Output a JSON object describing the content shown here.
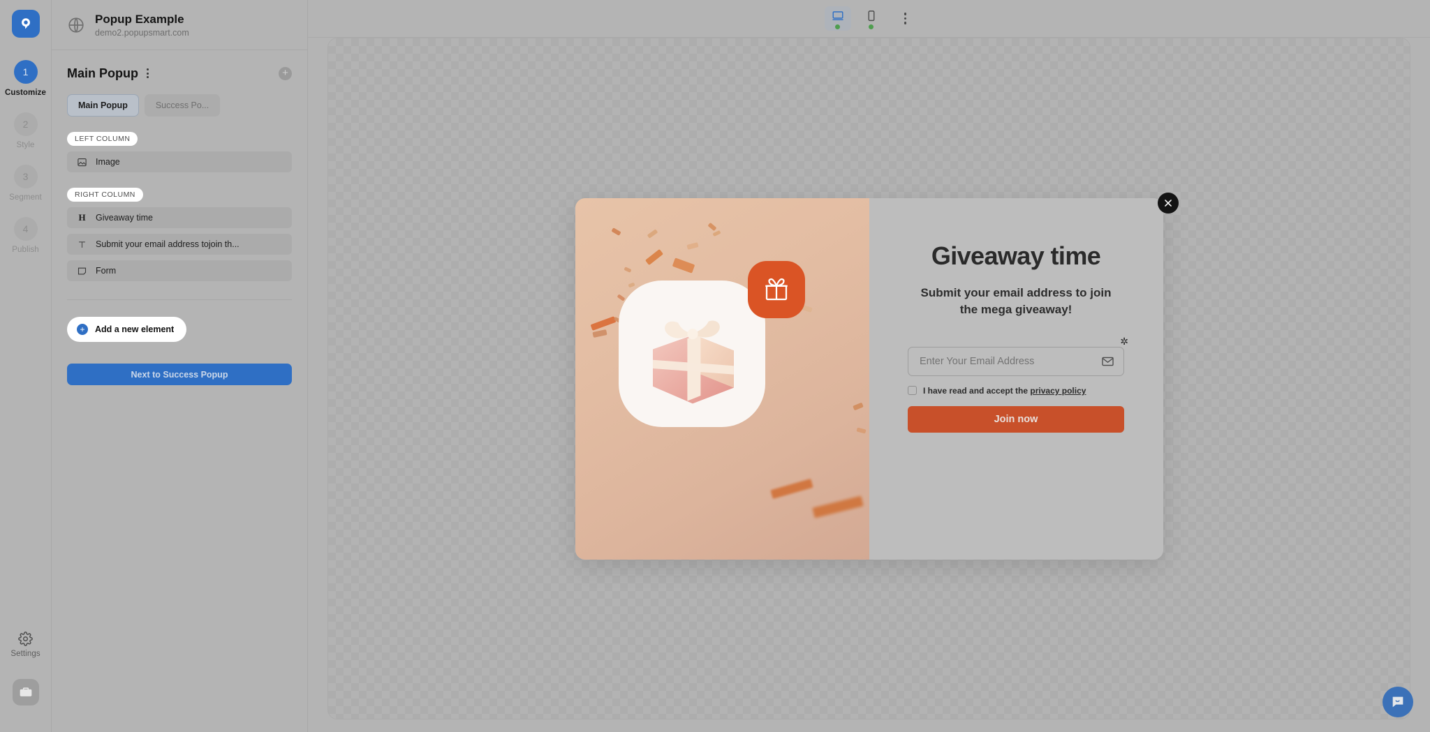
{
  "rail": {
    "logo_icon": "popupsmart-logo-icon",
    "steps": [
      {
        "num": "1",
        "label": "Customize",
        "active": true
      },
      {
        "num": "2",
        "label": "Style",
        "active": false
      },
      {
        "num": "3",
        "label": "Segment",
        "active": false
      },
      {
        "num": "4",
        "label": "Publish",
        "active": false
      }
    ],
    "settings_label": "Settings",
    "settings_icon": "gear-icon",
    "briefcase_icon": "briefcase-icon"
  },
  "panel": {
    "globe_icon": "globe-icon",
    "site_title": "Popup Example",
    "site_url": "demo2.popupsmart.com",
    "header_title": "Main Popup",
    "kebab_icon": "kebab-menu-icon",
    "add_icon": "add-circle-icon",
    "tabs": [
      {
        "label": "Main Popup",
        "active": true
      },
      {
        "label": "Success Po...",
        "active": false
      }
    ],
    "groups": [
      {
        "tag": "LEFT COLUMN",
        "items": [
          {
            "icon": "image-icon",
            "label": "Image"
          }
        ]
      },
      {
        "tag": "RIGHT COLUMN",
        "items": [
          {
            "icon": "heading-icon",
            "label": "Giveaway time"
          },
          {
            "icon": "text-icon",
            "label": "Submit your email address tojoin th..."
          },
          {
            "icon": "form-icon",
            "label": "Form"
          }
        ]
      }
    ],
    "add_element_label": "Add a new element",
    "add_element_icon": "plus-circle-icon",
    "next_button_label": "Next to Success Popup"
  },
  "topbar": {
    "desktop_icon": "desktop-icon",
    "mobile_icon": "mobile-icon",
    "kebab_icon": "kebab-menu-icon",
    "desktop_active": true,
    "status_color": "#4f9d4f"
  },
  "popup": {
    "close_icon": "close-icon",
    "left_image": {
      "name": "gift-illustration",
      "badge_icon": "gift-box-icon",
      "badge_color": "#da5425"
    },
    "title": "Giveaway time",
    "subtitle": "Submit your email address to join the mega giveaway!",
    "email_placeholder": "Enter Your Email Address",
    "email_value": "",
    "email_icon": "envelope-icon",
    "required_marker": "✲",
    "consent_text": "I have read and accept the ",
    "consent_link": "privacy policy",
    "submit_label": "Join now",
    "submit_color": "#c8502a"
  },
  "chat": {
    "icon": "chat-bubble-icon",
    "color": "#3b71b8"
  }
}
